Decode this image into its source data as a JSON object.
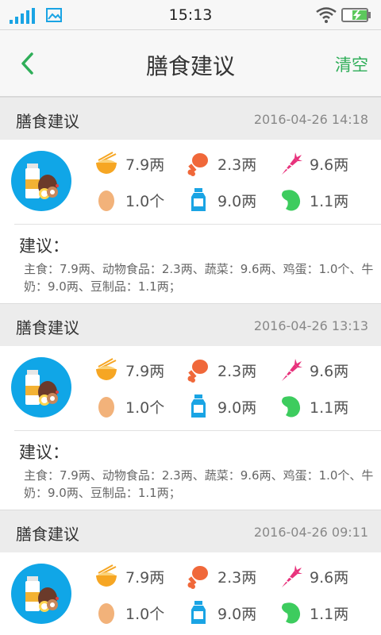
{
  "status_bar": {
    "time": "15:13"
  },
  "header": {
    "title": "膳食建议",
    "clear_label": "清空"
  },
  "records": [
    {
      "title": "膳食建议",
      "time": "2016-04-26 14:18",
      "nutrients": [
        {
          "icon": "rice-bowl-icon",
          "value": "7.9两"
        },
        {
          "icon": "chicken-leg-icon",
          "value": "2.3两"
        },
        {
          "icon": "carrot-icon",
          "value": "9.6两"
        },
        {
          "icon": "egg-icon",
          "value": "1.0个"
        },
        {
          "icon": "milk-bottle-icon",
          "value": "9.0两"
        },
        {
          "icon": "bean-icon",
          "value": "1.1两"
        }
      ],
      "advice_title": "建议：",
      "advice_text": "主食：7.9两、动物食品：2.3两、蔬菜：9.6两、鸡蛋：1.0个、牛奶：9.0两、豆制品：1.1两；"
    },
    {
      "title": "膳食建议",
      "time": "2016-04-26 13:13",
      "nutrients": [
        {
          "icon": "rice-bowl-icon",
          "value": "7.9两"
        },
        {
          "icon": "chicken-leg-icon",
          "value": "2.3两"
        },
        {
          "icon": "carrot-icon",
          "value": "9.6两"
        },
        {
          "icon": "egg-icon",
          "value": "1.0个"
        },
        {
          "icon": "milk-bottle-icon",
          "value": "9.0两"
        },
        {
          "icon": "bean-icon",
          "value": "1.1两"
        }
      ],
      "advice_title": "建议：",
      "advice_text": "主食：7.9两、动物食品：2.3两、蔬菜：9.6两、鸡蛋：1.0个、牛奶：9.0两、豆制品：1.1两；"
    },
    {
      "title": "膳食建议",
      "time": "2016-04-26 09:11",
      "nutrients": [
        {
          "icon": "rice-bowl-icon",
          "value": "7.9两"
        },
        {
          "icon": "chicken-leg-icon",
          "value": "2.3两"
        },
        {
          "icon": "carrot-icon",
          "value": "9.6两"
        },
        {
          "icon": "egg-icon",
          "value": "1.0个"
        },
        {
          "icon": "milk-bottle-icon",
          "value": "9.0两"
        },
        {
          "icon": "bean-icon",
          "value": "1.1两"
        }
      ]
    }
  ],
  "colors": {
    "accent": "#2fae59",
    "avatar_bg": "#10a6e7",
    "rice": "#f6a623",
    "meat": "#f0683a",
    "carrot": "#e8327c",
    "egg": "#f2b27a",
    "milk": "#1aa4e4",
    "bean": "#3dcc5e"
  }
}
